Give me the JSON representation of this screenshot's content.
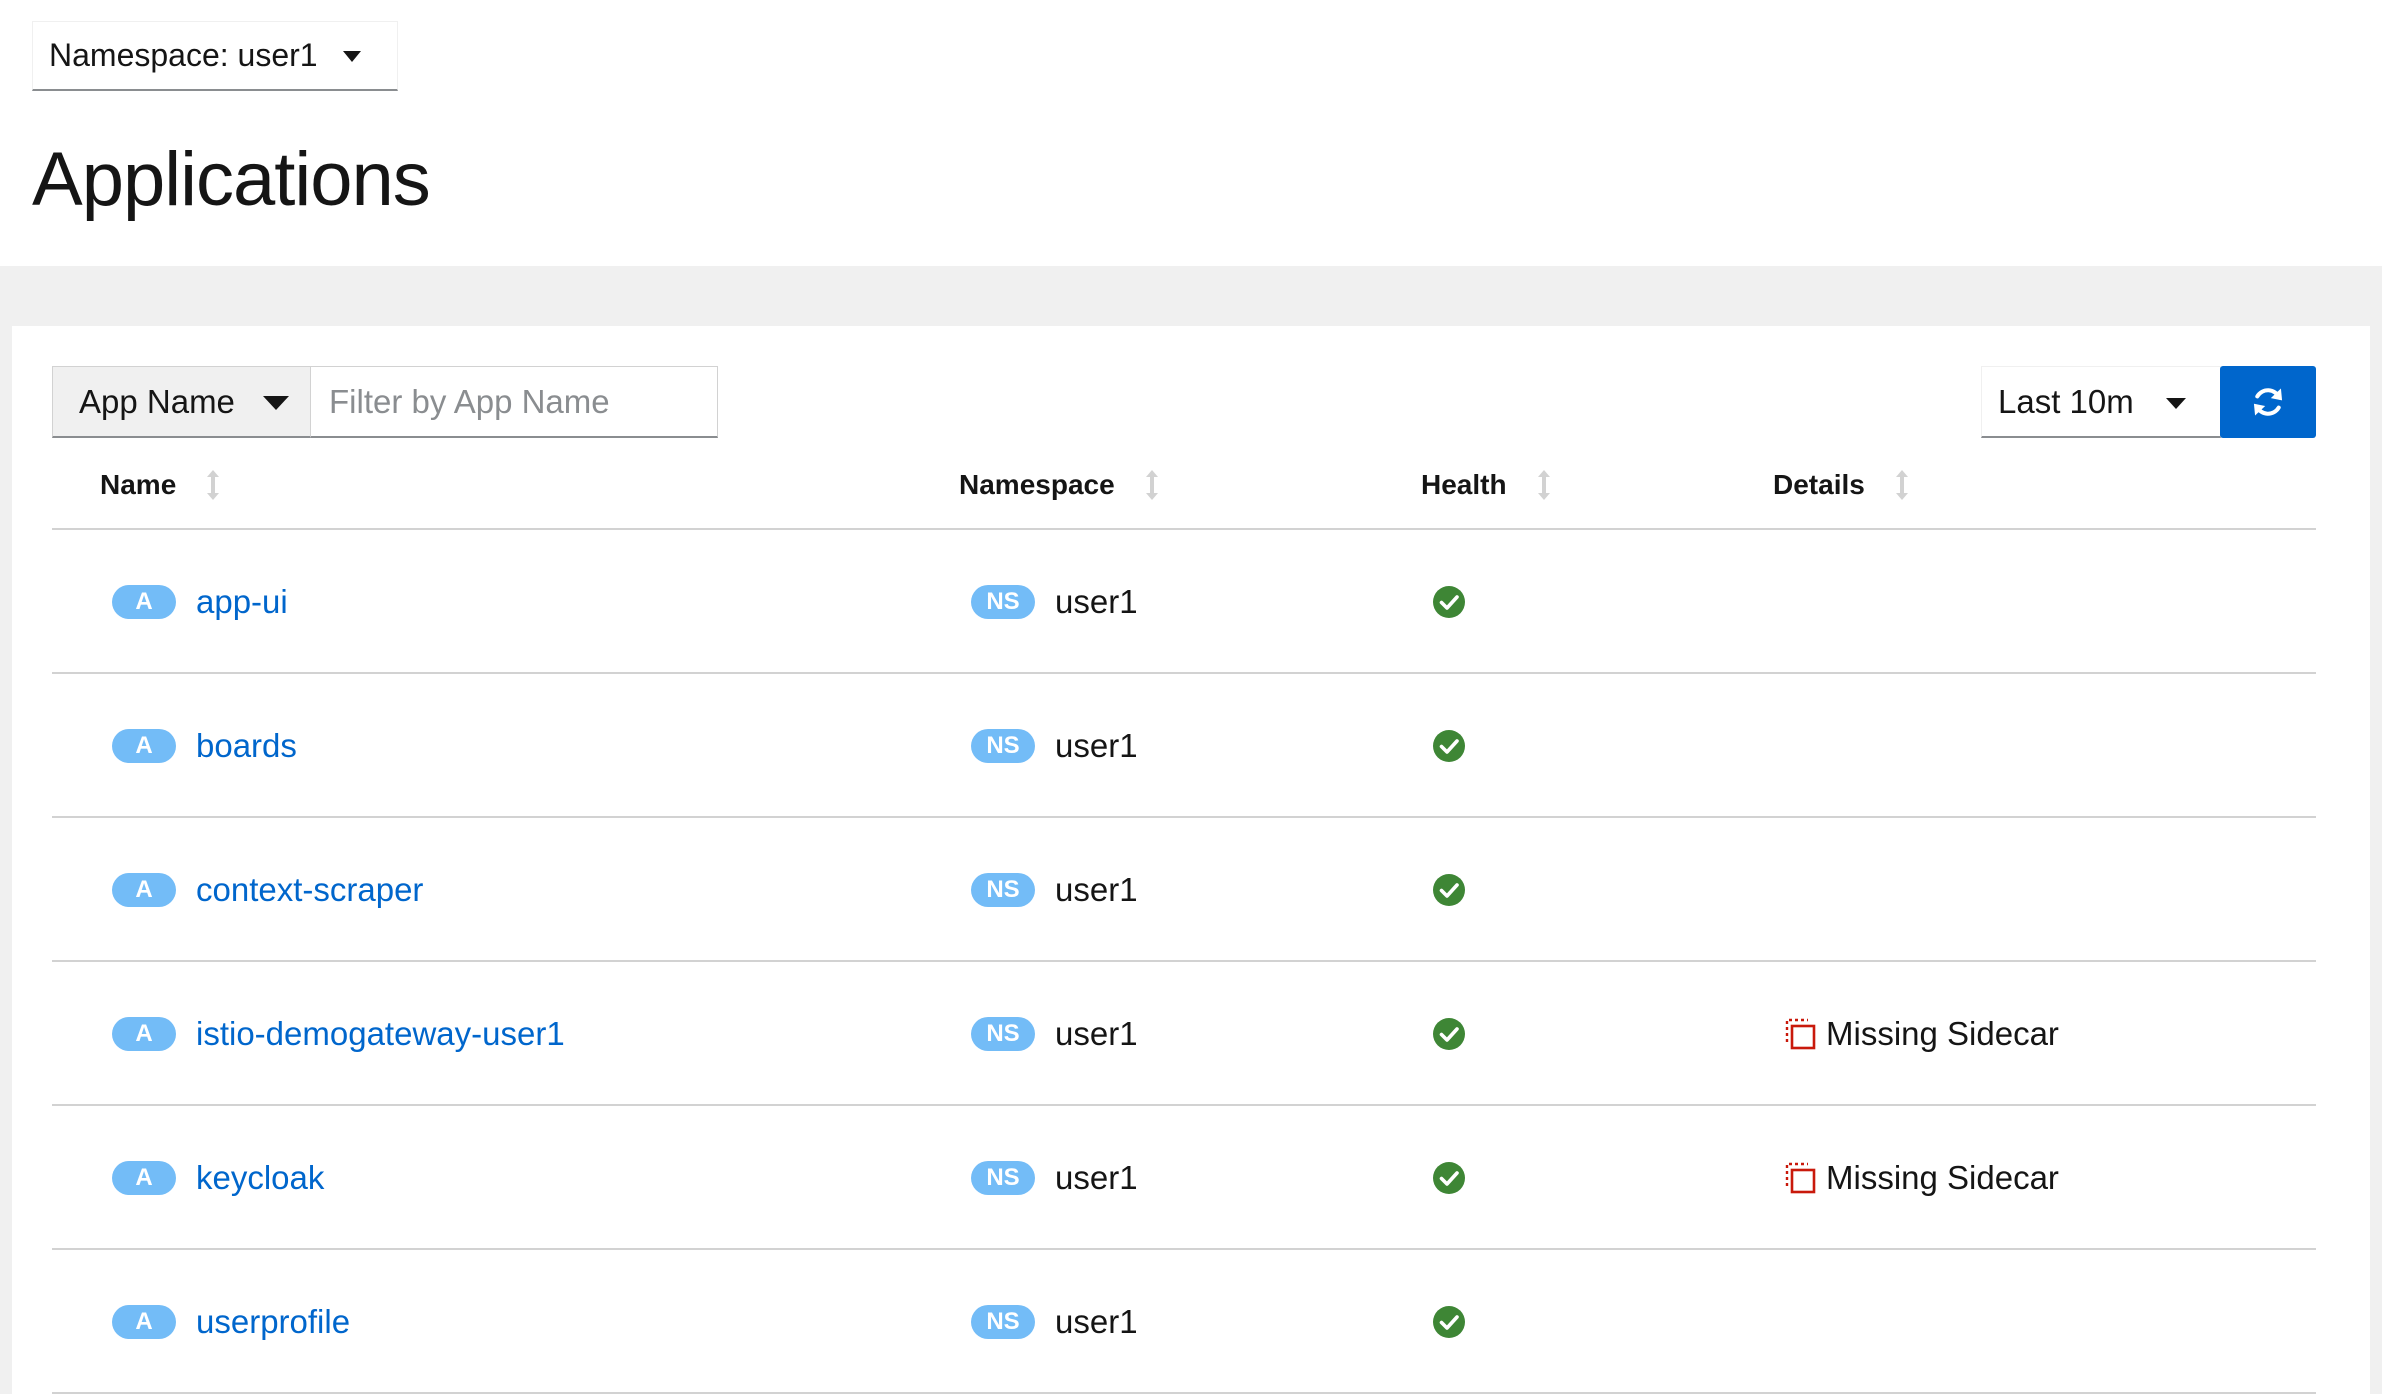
{
  "namespace_selector": {
    "label": "Namespace: user1"
  },
  "page": {
    "title": "Applications"
  },
  "toolbar": {
    "filter_type_label": "App Name",
    "filter_placeholder": "Filter by App Name",
    "time_range_label": "Last 10m",
    "refresh_icon": "sync-icon"
  },
  "table": {
    "columns": [
      {
        "label": "Name"
      },
      {
        "label": "Namespace"
      },
      {
        "label": "Health"
      },
      {
        "label": "Details"
      }
    ],
    "rows": [
      {
        "badge": "A",
        "name": "app-ui",
        "ns_badge": "NS",
        "namespace": "user1",
        "health": "healthy",
        "details": ""
      },
      {
        "badge": "A",
        "name": "boards",
        "ns_badge": "NS",
        "namespace": "user1",
        "health": "healthy",
        "details": ""
      },
      {
        "badge": "A",
        "name": "context-scraper",
        "ns_badge": "NS",
        "namespace": "user1",
        "health": "healthy",
        "details": ""
      },
      {
        "badge": "A",
        "name": "istio-demogateway-user1",
        "ns_badge": "NS",
        "namespace": "user1",
        "health": "healthy",
        "details": "Missing Sidecar"
      },
      {
        "badge": "A",
        "name": "keycloak",
        "ns_badge": "NS",
        "namespace": "user1",
        "health": "healthy",
        "details": "Missing Sidecar"
      },
      {
        "badge": "A",
        "name": "userprofile",
        "ns_badge": "NS",
        "namespace": "user1",
        "health": "healthy",
        "details": ""
      }
    ]
  },
  "colors": {
    "link": "#0066cc",
    "badge": "#73bcf7",
    "healthy": "#3e8635",
    "warning": "#c9190b",
    "primary_button": "#0066cc"
  }
}
